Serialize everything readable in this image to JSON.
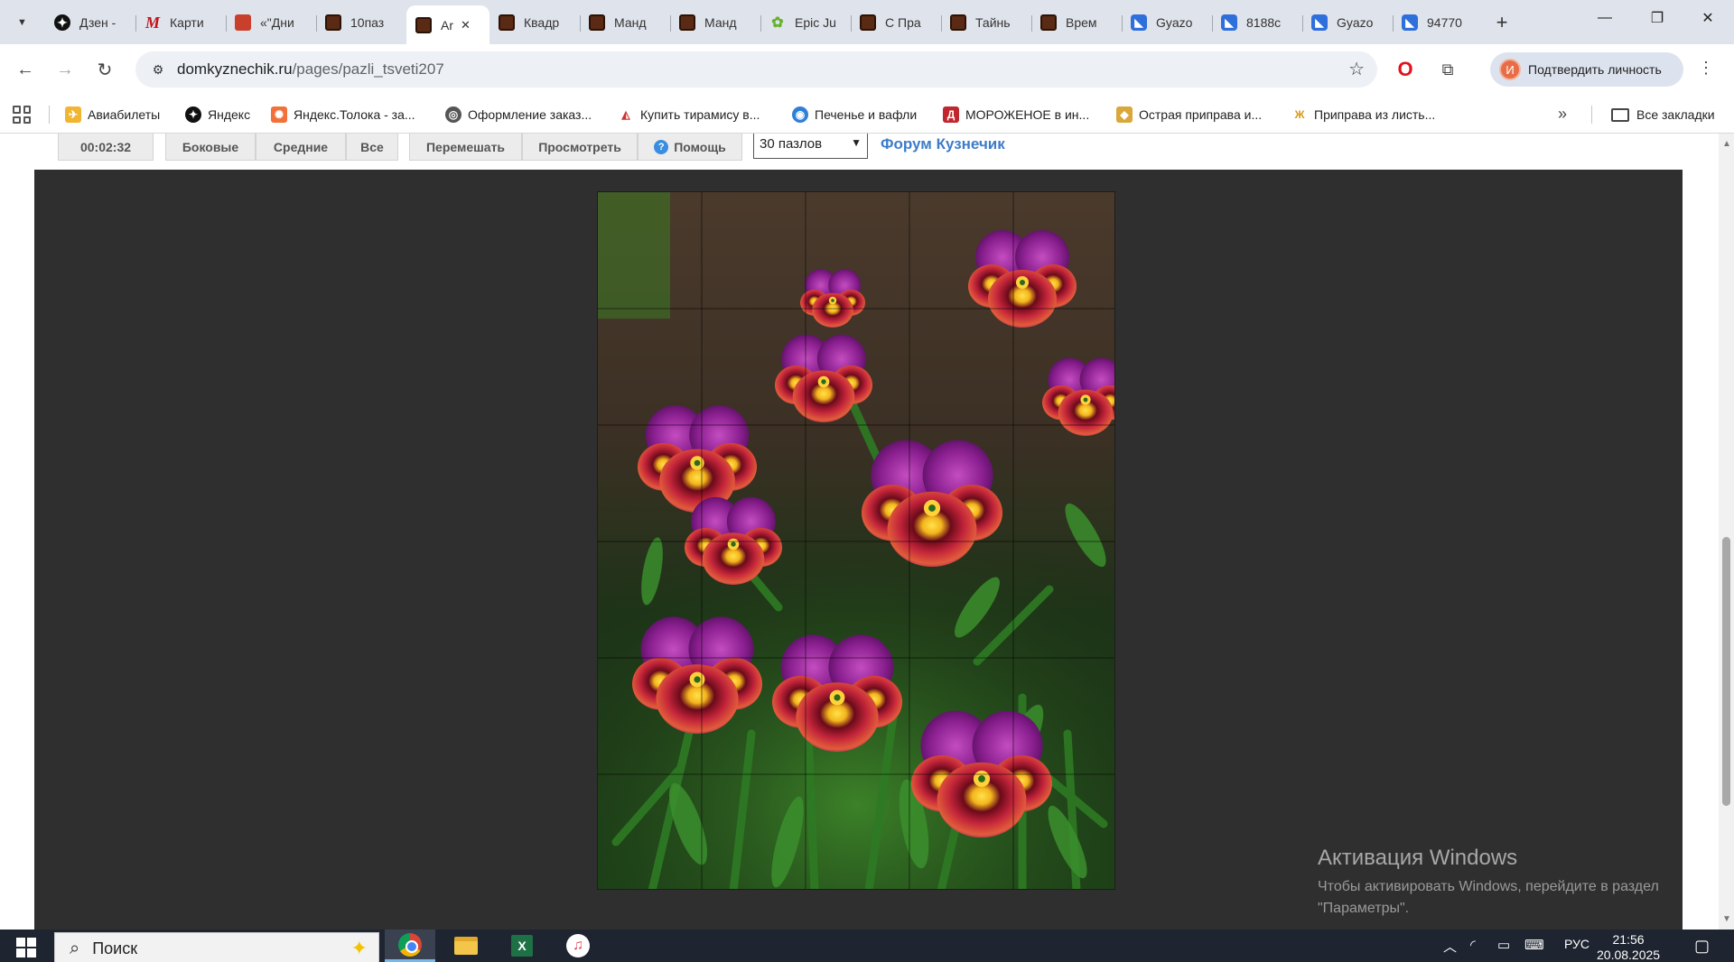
{
  "tabs": [
    {
      "title": "Дзен -",
      "favicon": "dzen-icon"
    },
    {
      "title": "Карти",
      "favicon": "m-logo-icon"
    },
    {
      "title": "«\"Дни",
      "favicon": "red-image-icon"
    },
    {
      "title": "10паз",
      "favicon": "puzzle-favicon"
    },
    {
      "title": "Ar",
      "favicon": "puzzle-favicon",
      "active": true
    },
    {
      "title": "Квадр",
      "favicon": "puzzle-favicon"
    },
    {
      "title": "Манд",
      "favicon": "puzzle-favicon"
    },
    {
      "title": "Манд",
      "favicon": "puzzle-favicon"
    },
    {
      "title": "Epic Ju",
      "favicon": "jigsaw-green-icon"
    },
    {
      "title": "С Пра",
      "favicon": "puzzle-favicon"
    },
    {
      "title": "Тайнь",
      "favicon": "puzzle-favicon"
    },
    {
      "title": "Врем",
      "favicon": "puzzle-favicon"
    },
    {
      "title": "Gyazo",
      "favicon": "gyazo-icon"
    },
    {
      "title": "8188c",
      "favicon": "gyazo-icon"
    },
    {
      "title": "Gyazo",
      "favicon": "gyazo-icon"
    },
    {
      "title": "94770",
      "favicon": "gyazo-icon"
    }
  ],
  "toolbar": {
    "url_domain": "domkyznechik.ru",
    "url_path": "/pages/pazli_tsveti207",
    "profile_initial": "И",
    "profile_label": "Подтвердить личность"
  },
  "bookmarks": {
    "items": [
      {
        "label": "Авиабилеты",
        "icon": "plane-icon"
      },
      {
        "label": "Яндекс",
        "icon": "yandex-icon"
      },
      {
        "label": "Яндекс.Толока - за...",
        "icon": "toloka-icon"
      },
      {
        "label": "Оформление заказ...",
        "icon": "globe-icon"
      },
      {
        "label": "Купить тирамису в...",
        "icon": "cake-icon"
      },
      {
        "label": "Печенье и вафли",
        "icon": "cookie-icon"
      },
      {
        "label": "МОРОЖЕНОЕ в ин...",
        "icon": "d-logo-icon"
      },
      {
        "label": "Острая приправа и...",
        "icon": "spice-icon"
      },
      {
        "label": "Приправа из листь...",
        "icon": "leaf-icon"
      }
    ],
    "all_bookmarks_label": "Все закладки"
  },
  "puzzle": {
    "timer": "00:02:32",
    "buttons": {
      "side": "Боковые",
      "middle": "Средние",
      "all": "Все",
      "shuffle": "Перемешать",
      "preview": "Просмотреть",
      "help": "Помощь"
    },
    "pieces_selected": "30 пазлов",
    "forum_link": "Форум Кузнечик",
    "grid_columns": 5,
    "grid_rows": 6
  },
  "watermark": {
    "title": "Активация Windows",
    "line1": "Чтобы активировать Windows, перейдите в раздел",
    "line2": "\"Параметры\"."
  },
  "taskbar": {
    "search_placeholder": "Поиск",
    "language": "РУС",
    "time": "21:56",
    "date": "20.08.2025"
  },
  "colors": {
    "tabstrip_bg": "#dfe3eb",
    "board_bg": "#2f2f2f",
    "forum_link": "#3d7cc9",
    "taskbar_bg": "#1e2430"
  }
}
